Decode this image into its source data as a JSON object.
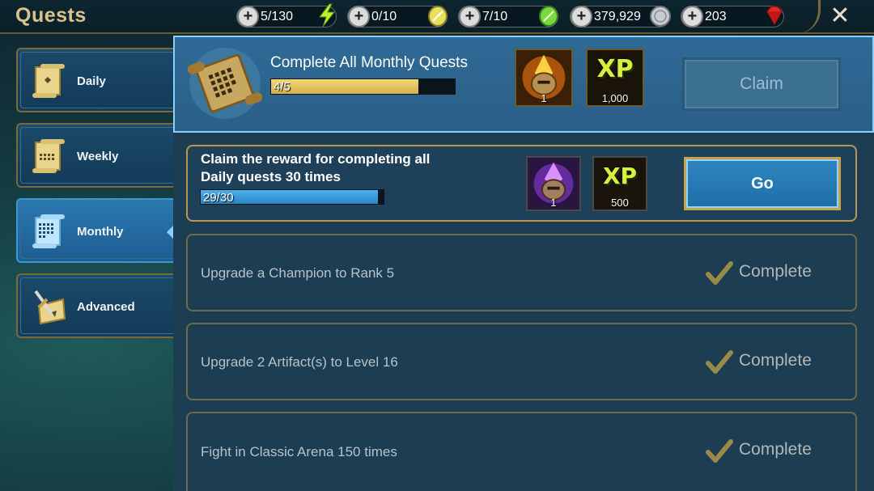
{
  "header": {
    "title": "Quests",
    "resources": [
      {
        "value": "5/130",
        "icon": "energy-icon"
      },
      {
        "value": "0/10",
        "icon": "yellow-token-icon"
      },
      {
        "value": "7/10",
        "icon": "green-token-icon"
      },
      {
        "value": "379,929",
        "icon": "silver-coin-icon"
      },
      {
        "value": "203",
        "icon": "gem-icon"
      }
    ],
    "close": "✕"
  },
  "sidebar": {
    "tabs": [
      {
        "label": "Daily",
        "active": false
      },
      {
        "label": "Weekly",
        "active": false
      },
      {
        "label": "Monthly",
        "active": true
      },
      {
        "label": "Advanced",
        "active": false
      }
    ]
  },
  "monthly_header": {
    "title": "Complete All Monthly Quests",
    "progress_text": "4/5",
    "progress": 0.8,
    "rewards": [
      {
        "icon": "legendary-chicken-icon",
        "count": "1"
      },
      {
        "icon": "xp-icon",
        "label": "XP",
        "count": "1,000"
      }
    ],
    "claim_label": "Claim"
  },
  "quests": [
    {
      "text_line1": "Claim the reward for completing all",
      "text_line2": "Daily quests 30 times",
      "progress_text": "29/30",
      "progress": 0.967,
      "rewards": [
        {
          "icon": "epic-chicken-icon",
          "count": "1"
        },
        {
          "icon": "xp-icon",
          "label": "XP",
          "count": "500"
        }
      ],
      "action_label": "Go"
    },
    {
      "text": "Upgrade a Champion to Rank 5",
      "status": "Complete"
    },
    {
      "text": "Upgrade 2 Artifact(s) to Level 16",
      "status": "Complete"
    },
    {
      "text": "Fight in Classic Arena 150 times",
      "status": "Complete"
    }
  ],
  "colors": {
    "gold_border": "#b59a4e",
    "header_blue": "#2f6a96",
    "progress_gold": "#e6c55a",
    "progress_blue": "#3a9ad8",
    "xp_green": "#d6f040"
  }
}
